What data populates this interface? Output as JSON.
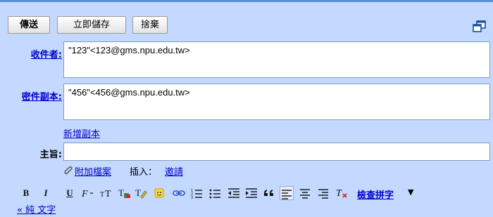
{
  "toolbar": {
    "send_label": "傳送",
    "save_label": "立即儲存",
    "discard_label": "捨棄"
  },
  "to": {
    "label": "收件者:",
    "value": "\"123\"<123@gms.npu.edu.tw>"
  },
  "cc": {
    "label": "密件副本:",
    "value": "\"456\"<456@gms.npu.edu.tw>"
  },
  "add_cc_label": "新增副本",
  "subject": {
    "label": "主旨:",
    "value": ""
  },
  "attach": {
    "attach_label": "附加檔案",
    "insert_label": "插入：",
    "invite_label": "邀請"
  },
  "format_bar": {
    "bold": "B",
    "italic": "I",
    "underline": "U",
    "spellcheck_label": "檢查拼字",
    "spellcheck_arrow": "▼",
    "plain_text_label": "« 純 文字"
  },
  "colors": {
    "frame_bg": "#c3d9ff",
    "link": "#0000cc",
    "top_border": "#5b8fd6"
  }
}
